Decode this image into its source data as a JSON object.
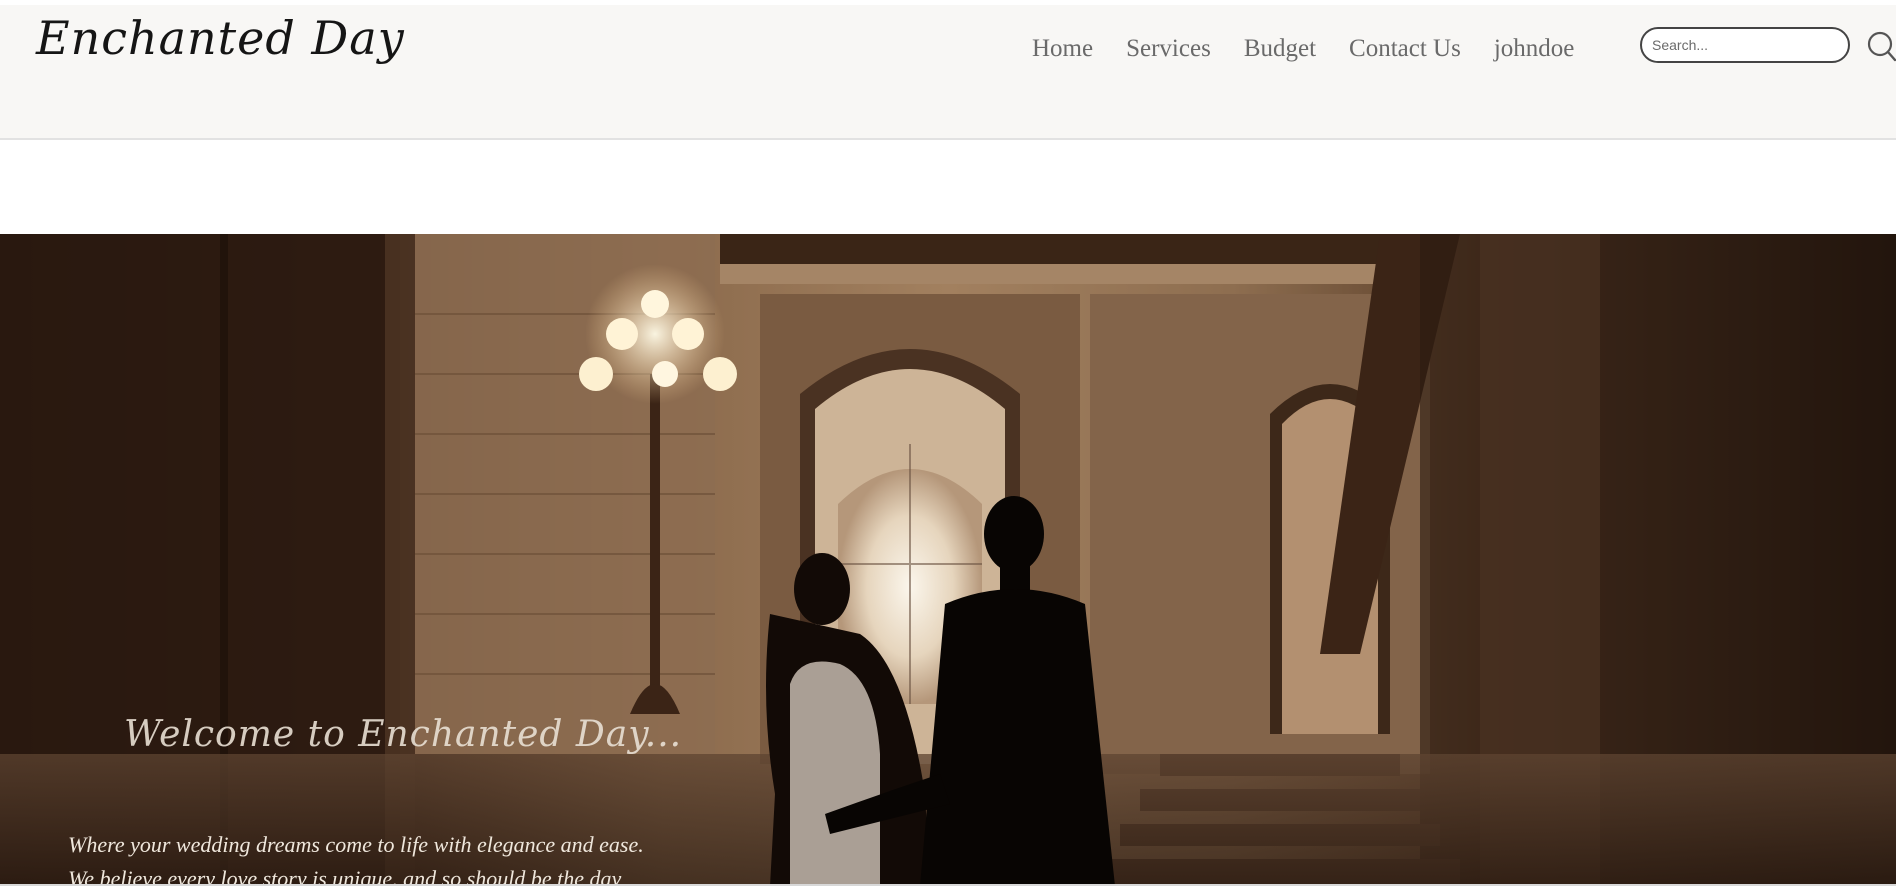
{
  "brand": {
    "logo_text": "Enchanted Day"
  },
  "nav": {
    "items": [
      "Home",
      "Services",
      "Budget",
      "Contact Us",
      "johndoe"
    ]
  },
  "search": {
    "placeholder": "Search...",
    "icon": "search-icon"
  },
  "hero": {
    "title": "Welcome to Enchanted Day...",
    "line1": "Where your wedding dreams come to life with elegance and ease.",
    "line2": "We believe every love story is unique, and so should be the day"
  },
  "colors": {
    "header_bg": "#f8f7f5",
    "nav_text": "#6a6a6a",
    "hero_text": "#efe7dc"
  }
}
